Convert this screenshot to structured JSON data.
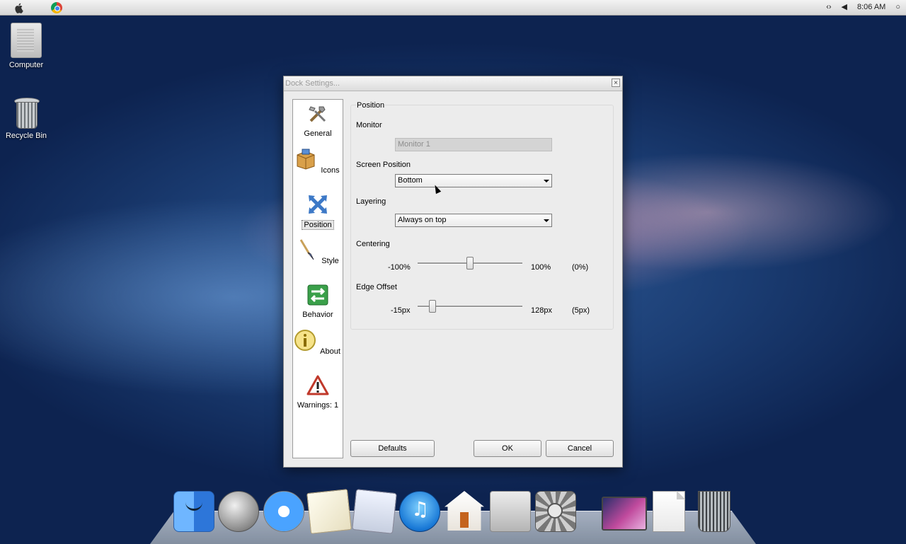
{
  "menubar": {
    "clock": "8:06 AM",
    "icons": [
      "apple-icon",
      "chrome-icon",
      "code-icon",
      "volume-icon",
      "spotlight-icon"
    ]
  },
  "desktop": {
    "icons": [
      {
        "label": "Computer",
        "icon": "computer-icon"
      },
      {
        "label": "Recycle Bin",
        "icon": "recycle-bin-icon"
      }
    ]
  },
  "dialog": {
    "title": "Dock Settings...",
    "close_glyph": "×",
    "sidebar": [
      {
        "label": "General",
        "icon": "tools-icon"
      },
      {
        "label": "Icons",
        "icon": "box-icon"
      },
      {
        "label": "Position",
        "icon": "move-arrows-icon",
        "active": true
      },
      {
        "label": "Style",
        "icon": "brush-icon"
      },
      {
        "label": "Behavior",
        "icon": "arrows-swap-icon"
      },
      {
        "label": "About",
        "icon": "info-icon"
      },
      {
        "label": "Warnings: 1",
        "icon": "warning-icon"
      }
    ],
    "section": {
      "legend": "Position",
      "monitor_label": "Monitor",
      "monitor_value": "Monitor 1",
      "screen_position_label": "Screen Position",
      "screen_position_value": "Bottom",
      "layering_label": "Layering",
      "layering_value": "Always on top",
      "centering": {
        "label": "Centering",
        "min": "-100%",
        "max": "100%",
        "current": "(0%)",
        "value_fraction": 0.5
      },
      "edge_offset": {
        "label": "Edge Offset",
        "min": "-15px",
        "max": "128px",
        "current": "(5px)",
        "value_fraction": 0.14
      }
    },
    "buttons": {
      "defaults": "Defaults",
      "ok": "OK",
      "cancel": "Cancel"
    }
  },
  "dock": {
    "items": [
      "finder-icon",
      "launchpad-icon",
      "safari-icon",
      "mail-icon",
      "photo-icon",
      "itunes-icon",
      "home-icon",
      "mac-pro-icon",
      "system-preferences-icon",
      "screen-icon",
      "document-icon",
      "trash-icon"
    ]
  }
}
